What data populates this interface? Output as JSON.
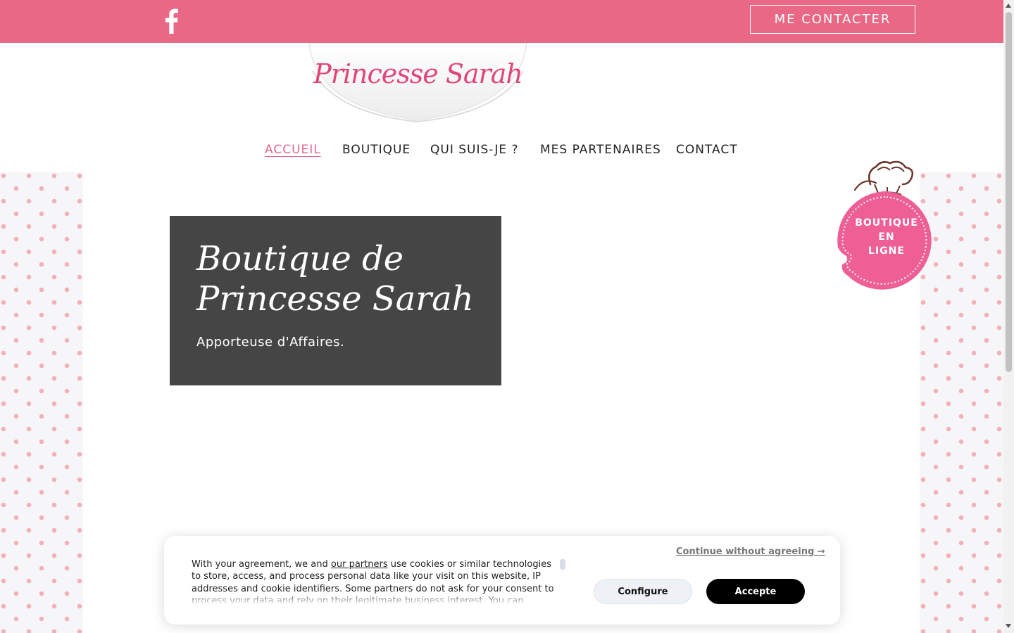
{
  "topbar": {
    "social_icon": "facebook-icon",
    "contact_button": "ME CONTACTER",
    "color": "#e96885"
  },
  "logo": {
    "text": "Princesse Sarah",
    "color": "#e0457a"
  },
  "nav": {
    "items": [
      {
        "label": "ACCUEIL",
        "active": true
      },
      {
        "label": "BOUTIQUE",
        "active": false
      },
      {
        "label": "QUI SUIS-JE ?",
        "active": false
      },
      {
        "label": "MES PARTENAIRES",
        "active": false
      },
      {
        "label": "CONTACT",
        "active": false
      }
    ]
  },
  "hero": {
    "title_line1": "Boutique de",
    "title_line2": "Princesse Sarah",
    "subtitle": "Apporteuse d'Affaires.",
    "background": "#454545"
  },
  "badge": {
    "line1": "BOUTIQUE",
    "line2": "EN",
    "line3": "LIGNE",
    "icon": "chef-hat-icon",
    "color": "#ee5f96"
  },
  "cookie": {
    "text_before": "With your agreement, we and ",
    "link": "our partners",
    "text_after": " use cookies or similar technologies to store, access, and process personal data like your visit on this website, IP addresses and cookie identifiers. Some partners do not ask for your consent to process your data and rely on their legitimate business interest. You can",
    "continue": "Continue without agreeing →",
    "configure": "Configure",
    "accept": "Accepte"
  }
}
